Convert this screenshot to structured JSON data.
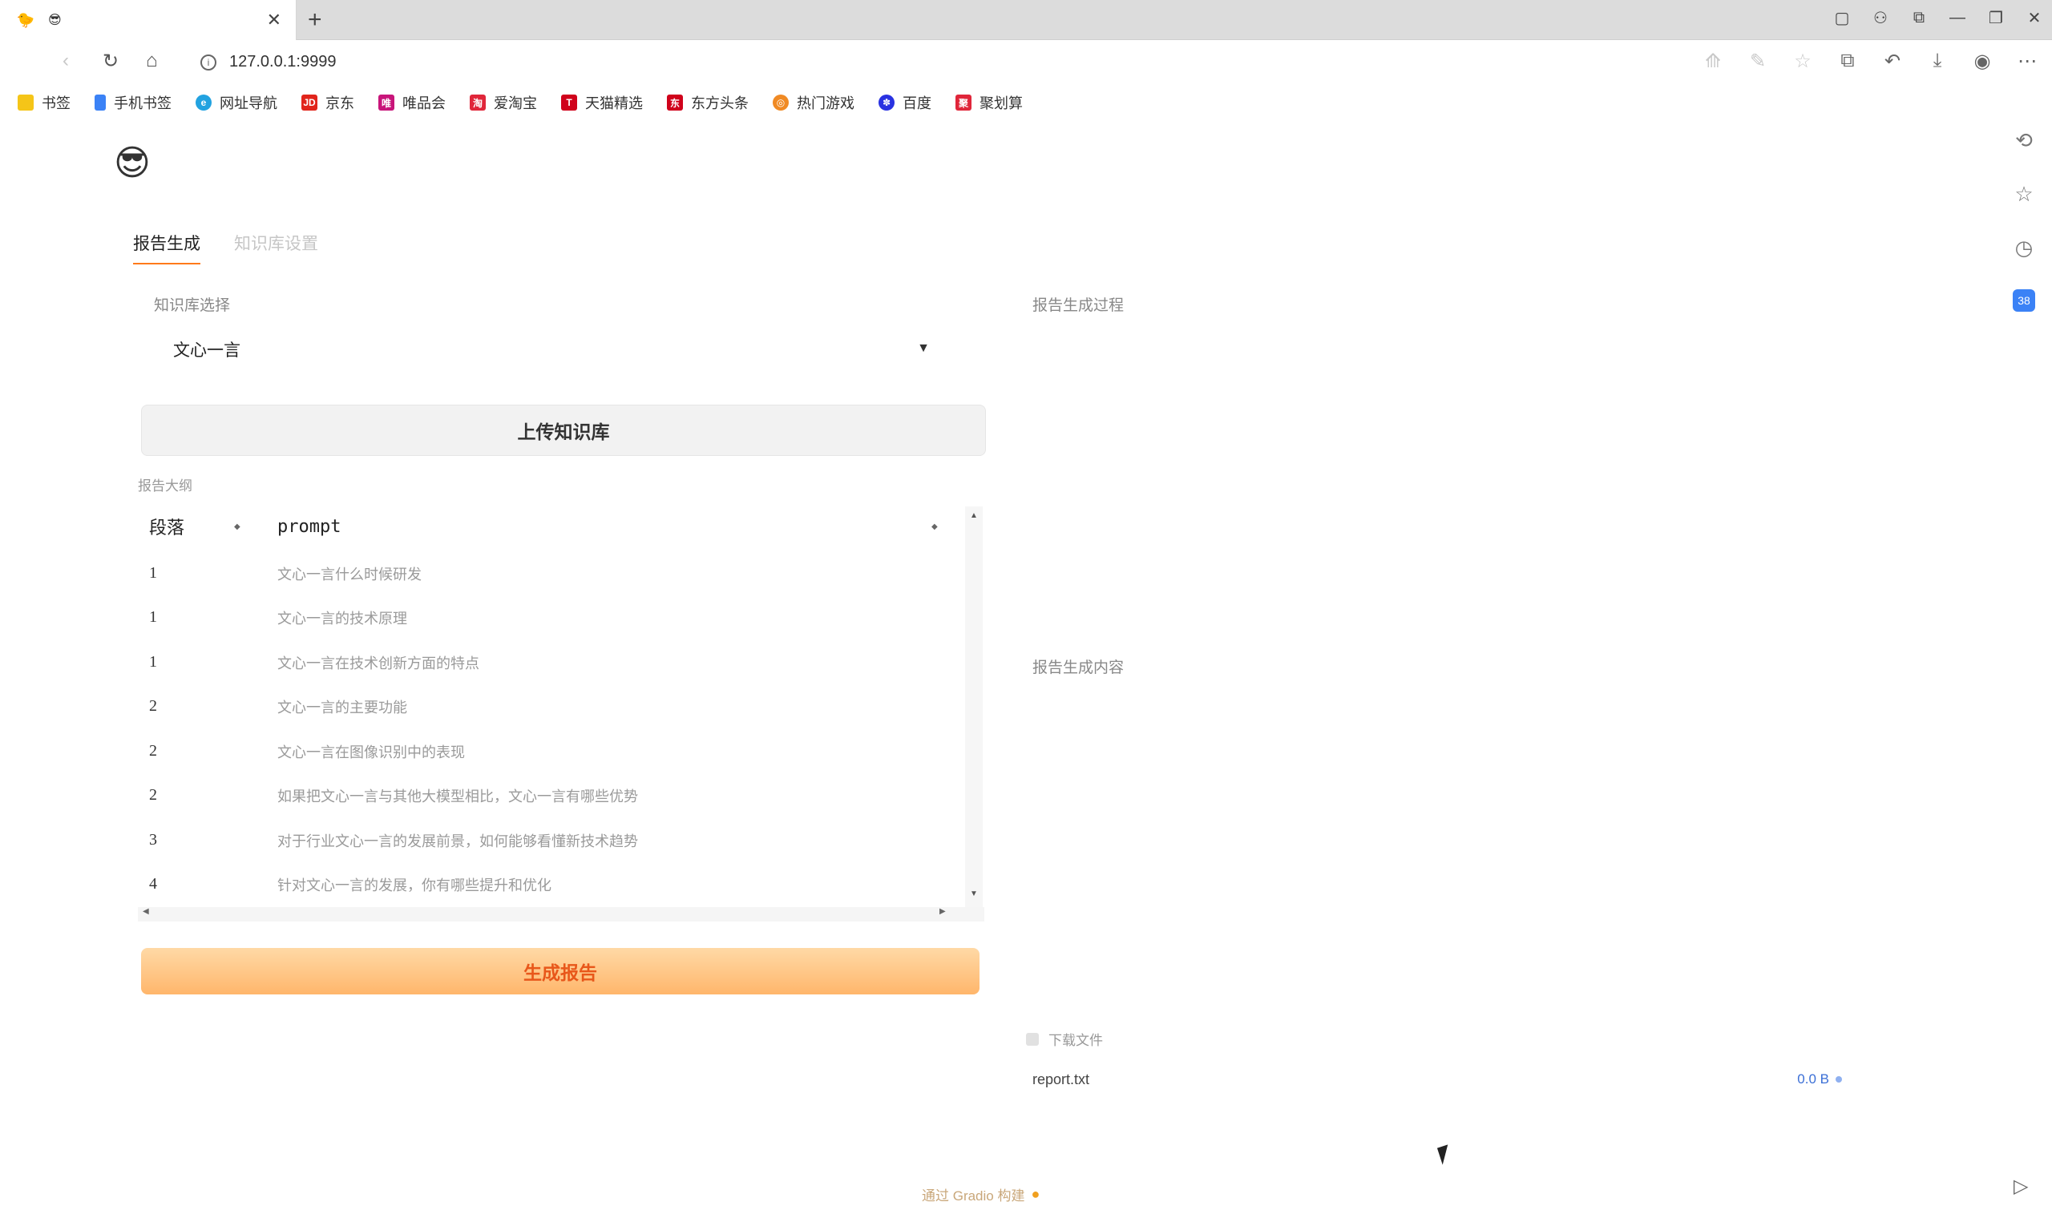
{
  "browser": {
    "tab_title": "😎",
    "url": "127.0.0.1:9999",
    "bookmarks": [
      {
        "label": "书签",
        "color": "#f5c518",
        "glyph": ""
      },
      {
        "label": "手机书签",
        "color": "#3b82f6",
        "glyph": ""
      },
      {
        "label": "网址导航",
        "color": "#22a2e0",
        "glyph": "e"
      },
      {
        "label": "京东",
        "color": "#e1251b",
        "glyph": "JD"
      },
      {
        "label": "唯品会",
        "color": "#c8157a",
        "glyph": "唯"
      },
      {
        "label": "爱淘宝",
        "color": "#e0263a",
        "glyph": "淘"
      },
      {
        "label": "天猫精选",
        "color": "#d0021b",
        "glyph": "T"
      },
      {
        "label": "东方头条",
        "color": "#d0021b",
        "glyph": "东"
      },
      {
        "label": "热门游戏",
        "color": "#f08a24",
        "glyph": "◎"
      },
      {
        "label": "百度",
        "color": "#2932e1",
        "glyph": "✽"
      },
      {
        "label": "聚划算",
        "color": "#e0263a",
        "glyph": "聚"
      }
    ]
  },
  "app": {
    "logo": "😎",
    "tabs": [
      {
        "label": "报告生成"
      },
      {
        "label": "知识库设置"
      }
    ],
    "model_label": "知识库选择",
    "model_value": "文心一言",
    "upload_label": "上传知识库",
    "table_label": "报告大纲",
    "table": {
      "headers": [
        "段落",
        "prompt"
      ],
      "rows": [
        [
          "1",
          "文心一言什么时候研发"
        ],
        [
          "1",
          "文心一言的技术原理"
        ],
        [
          "1",
          "文心一言在技术创新方面的特点"
        ],
        [
          "2",
          "文心一言的主要功能"
        ],
        [
          "2",
          "文心一言在图像识别中的表现"
        ],
        [
          "2",
          "如果把文心一言与其他大模型相比，文心一言有哪些优势"
        ],
        [
          "3",
          "对于行业文心一言的发展前景，如何能够看懂新技术趋势"
        ],
        [
          "4",
          "针对文心一言的发展，你有哪些提升和优化"
        ]
      ]
    },
    "generate_label": "生成报告",
    "progress_label": "报告生成过程",
    "content_label": "报告生成内容",
    "download_label": "下载文件",
    "file": {
      "name": "report.txt",
      "size": "0.0 B"
    },
    "footer": "通过 Gradio 构建"
  }
}
